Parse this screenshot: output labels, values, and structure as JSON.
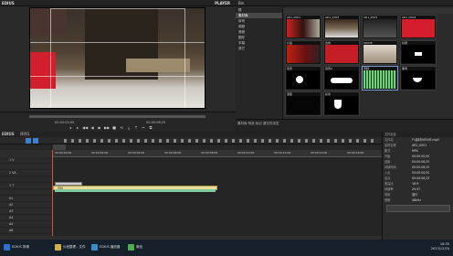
{
  "player": {
    "app_logo": "EDIUS",
    "mode_label": "PLAYER",
    "timecode_in": "00:00:00;00",
    "timecode_out": "00:00:06;25",
    "progress": 0.0
  },
  "transport_buttons": [
    "◂",
    "▸",
    "◀◀",
    "◀",
    "▶",
    "▶▶",
    "■",
    "⟲",
    "⤓",
    "⤒",
    "✂",
    "⧉"
  ],
  "bin": {
    "title": "Bin",
    "tree": [
      "根",
      "素材库",
      "序列",
      "视频",
      "音频",
      "图形",
      "字幕",
      "其它"
    ],
    "clips": [
      {
        "name": "AR1_0001"
      },
      {
        "name": "AR1_0002"
      },
      {
        "name": "AR1_0003"
      },
      {
        "name": "AR1_0004"
      },
      {
        "name": "片段"
      },
      {
        "name": "合成"
      },
      {
        "name": "MOVIE"
      },
      {
        "name": "标题"
      },
      {
        "name": "遮罩"
      },
      {
        "name": "遮罩2"
      },
      {
        "name": "音频"
      },
      {
        "name": "黑场"
      },
      {
        "name": "渐变"
      },
      {
        "name": "彩条"
      }
    ],
    "bottom_tabs": "素材库  特效  标记  源文件浏览"
  },
  "timeline": {
    "app_logo": "EDIUS",
    "sequence_label": "序列1",
    "ruler_ticks": [
      "00:00:00;00",
      "00:00:02;00",
      "00:00:04;00",
      "00:00:06;00",
      "00:00:08;00",
      "00:00:10;00",
      "00:00:12;00",
      "00:00:14;00",
      "00:00:16;00"
    ],
    "tracks": [
      "1 V",
      "",
      "2 VA",
      "",
      "1 T",
      "",
      "A1",
      "A2",
      "A3",
      "A4",
      "A5",
      "A6"
    ],
    "audio_clip_label": "音频"
  },
  "properties": {
    "title": "文件信息",
    "rows": [
      {
        "k": "文件名",
        "v": "F:\\素材\\MOVIE.mp4"
      },
      {
        "k": "素材名称",
        "v": "AR1_0001"
      },
      {
        "k": "格式",
        "v": "MP4"
      },
      {
        "k": "开始",
        "v": "00:00:00;00"
      },
      {
        "k": "结束",
        "v": "00:00:06;25"
      },
      {
        "k": "持续时间",
        "v": "00:00:06;25"
      },
      {
        "k": "入点",
        "v": "00:00:00;00"
      },
      {
        "k": "出点",
        "v": "00:00:06;25"
      },
      {
        "k": "宽高比",
        "v": "16:9"
      },
      {
        "k": "帧速率",
        "v": "29.97"
      },
      {
        "k": "场序",
        "v": "逐行"
      },
      {
        "k": "音频",
        "v": "48kHz"
      }
    ]
  },
  "taskbar": {
    "items": [
      {
        "label": "EDIUS 剪辑",
        "color": "#2f6fd1"
      },
      {
        "label": "片段整理 - 文件",
        "color": "#d1b34a"
      },
      {
        "label": "EDIUS 播放器",
        "color": "#3a8cc9"
      },
      {
        "label": "微信",
        "color": "#4cae4c"
      }
    ],
    "time": "16:35",
    "date": "2023/12/04"
  }
}
